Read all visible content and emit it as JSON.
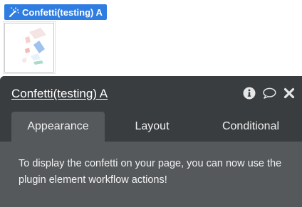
{
  "element": {
    "chip_label": "Confetti(testing) A",
    "icon": "magic-wand-icon"
  },
  "panel": {
    "title": "Confetti(testing) A",
    "header_icons": [
      "info-icon",
      "comment-icon",
      "close-icon"
    ],
    "tabs": [
      {
        "label": "Appearance",
        "active": true
      },
      {
        "label": "Layout",
        "active": false
      },
      {
        "label": "Conditional",
        "active": false
      }
    ],
    "body_text": "To display the confetti on your page, you can now use the plugin element workflow actions!"
  },
  "colors": {
    "chip_bg": "#2f7de1",
    "header_bg": "#3a3d40",
    "panel_bg": "#56595c"
  }
}
